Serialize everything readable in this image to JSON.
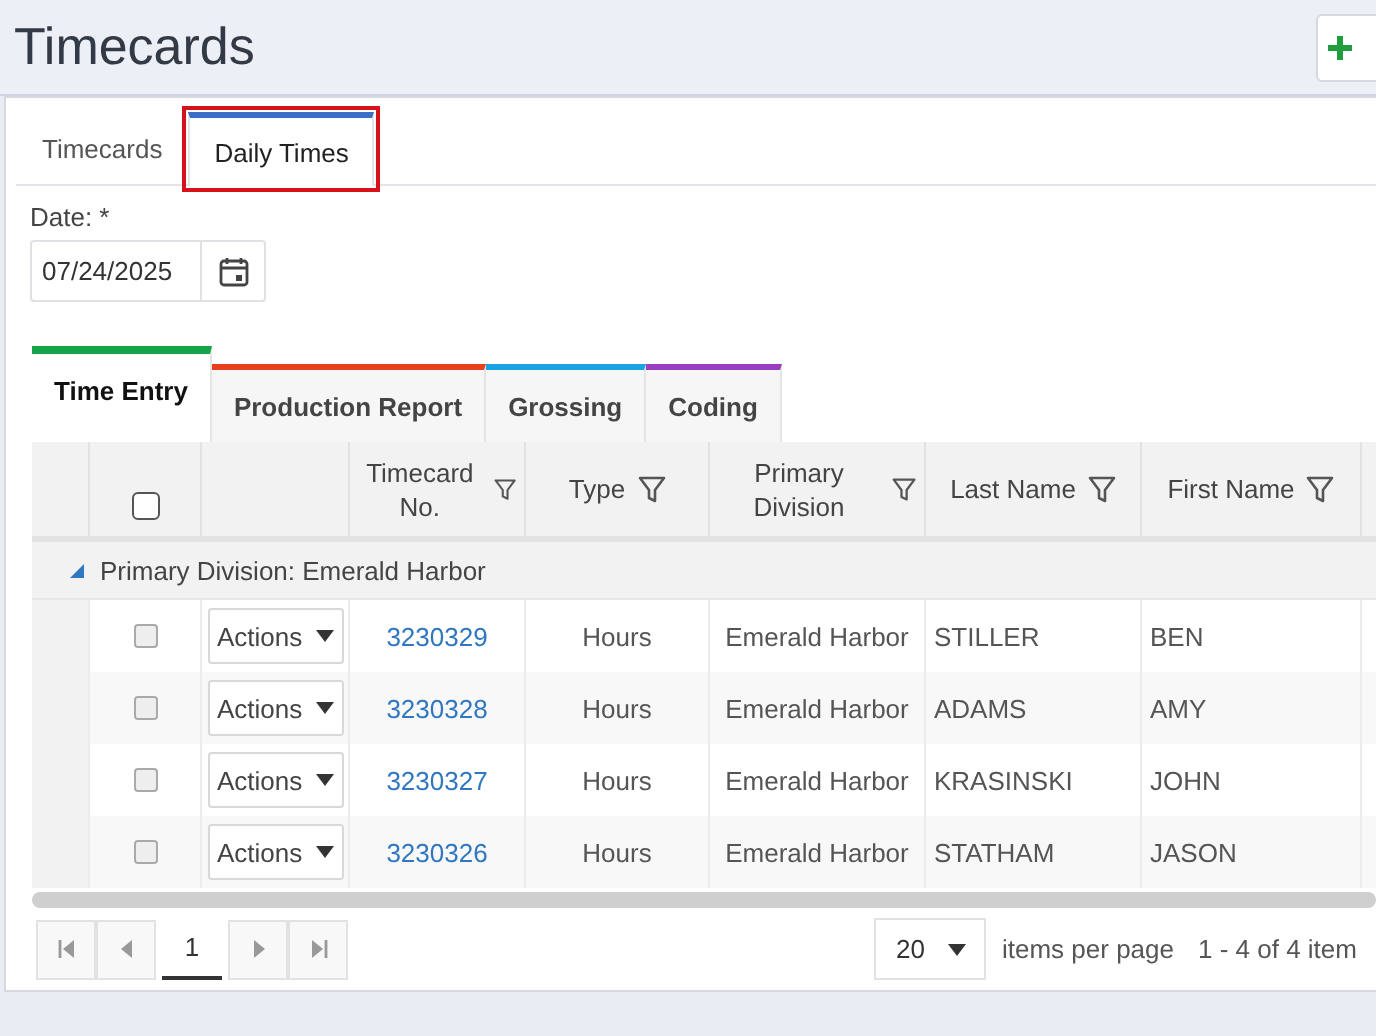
{
  "page": {
    "title": "Timecards"
  },
  "tabs": [
    {
      "label": "Timecards",
      "selected": false,
      "highlighted": false
    },
    {
      "label": "Daily Times",
      "selected": true,
      "highlighted": true
    }
  ],
  "date_field": {
    "label": "Date:",
    "required_mark": "*",
    "value": "07/24/2025"
  },
  "subtabs": [
    {
      "label": "Time Entry",
      "selected": true,
      "color": "#16a34a"
    },
    {
      "label": "Production Report",
      "selected": false,
      "color": "#e8401c"
    },
    {
      "label": "Grossing",
      "selected": false,
      "color": "#1aa3e0"
    },
    {
      "label": "Coding",
      "selected": false,
      "color": "#9b3fc0"
    }
  ],
  "table": {
    "select_all_checked": false,
    "columns": [
      {
        "label": "Timecard No.",
        "filter": true
      },
      {
        "label": "Type",
        "filter": true
      },
      {
        "label": "Primary Division",
        "filter": true
      },
      {
        "label": "Last Name",
        "filter": true
      },
      {
        "label": "First Name",
        "filter": true
      }
    ],
    "group": {
      "label": "Primary Division: Emerald Harbor",
      "expanded": true
    },
    "rows": [
      {
        "checked": false,
        "action": "Actions",
        "timecard_no": "3230329",
        "type": "Hours",
        "division": "Emerald Harbor",
        "last_name": "STILLER",
        "first_name": "BEN"
      },
      {
        "checked": false,
        "action": "Actions",
        "timecard_no": "3230328",
        "type": "Hours",
        "division": "Emerald Harbor",
        "last_name": "ADAMS",
        "first_name": "AMY"
      },
      {
        "checked": false,
        "action": "Actions",
        "timecard_no": "3230327",
        "type": "Hours",
        "division": "Emerald Harbor",
        "last_name": "KRASINSKI",
        "first_name": "JOHN"
      },
      {
        "checked": false,
        "action": "Actions",
        "timecard_no": "3230326",
        "type": "Hours",
        "division": "Emerald Harbor",
        "last_name": "STATHAM",
        "first_name": "JASON"
      }
    ]
  },
  "pager": {
    "page": "1",
    "page_size": "20",
    "page_size_label": "items per page",
    "info": "1 - 4 of 4 item"
  }
}
